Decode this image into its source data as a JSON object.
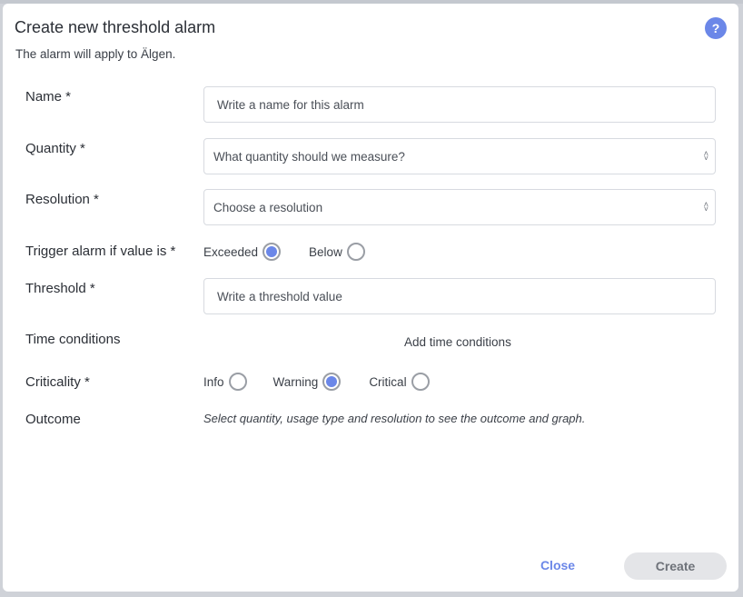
{
  "dialog": {
    "title": "Create new threshold alarm",
    "subtitle": "The alarm will apply to Älgen.",
    "help_icon": "?"
  },
  "form": {
    "name": {
      "label": "Name *",
      "placeholder": "Write a name for this alarm",
      "value": ""
    },
    "quantity": {
      "label": "Quantity *",
      "selected": "What quantity should we measure?"
    },
    "resolution": {
      "label": "Resolution *",
      "selected": "Choose a resolution"
    },
    "trigger": {
      "label": "Trigger alarm if value is *",
      "options": [
        {
          "label": "Exceeded",
          "checked": true
        },
        {
          "label": "Below",
          "checked": false
        }
      ]
    },
    "threshold": {
      "label": "Threshold *",
      "placeholder": "Write a threshold value",
      "value": ""
    },
    "time_conditions": {
      "label": "Time conditions",
      "link": "Add time conditions"
    },
    "criticality": {
      "label": "Criticality *",
      "options": [
        {
          "label": "Info",
          "checked": false
        },
        {
          "label": "Warning",
          "checked": true
        },
        {
          "label": "Critical",
          "checked": false
        }
      ]
    },
    "outcome": {
      "label": "Outcome",
      "text": "Select quantity, usage type and resolution to see the outcome and graph."
    }
  },
  "footer": {
    "close_label": "Close",
    "create_label": "Create"
  },
  "colors": {
    "accent": "#6b87e8",
    "create_bg": "#e4e5e8",
    "border": "#d7dae0"
  },
  "icons": {
    "help": "help-icon",
    "select_chevron": "chevron-up-down-icon"
  }
}
